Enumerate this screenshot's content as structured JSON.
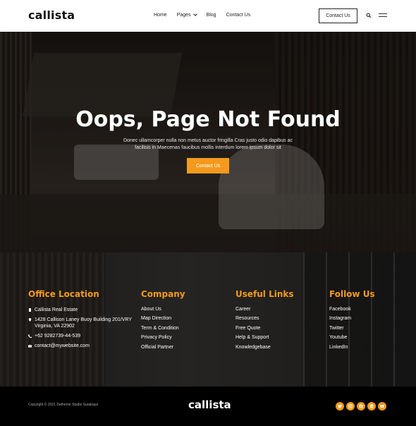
{
  "brand": {
    "name": "callista"
  },
  "nav": {
    "items": [
      "Home",
      "Pages",
      "Blog",
      "Contact Us"
    ],
    "cta_label": "Contact Us"
  },
  "hero": {
    "title": "Oops, Page Not Found",
    "subtitle": "Donec ullamcorper nulla non metus auctor fringilla Cras justo odio dapibus ac facilisis in Maecenas faucibus mollis interdum lorem ipsum dolor sit",
    "button_label": "Contact Us"
  },
  "footer": {
    "office": {
      "heading": "Office Location",
      "name": "Callista Real Estate",
      "address": "1428 Callison Laney Buoy Building 201/VRY Virginia, VA 22902",
      "phone": "+62 9282739-44-539",
      "email": "contact@mywebsite.com"
    },
    "company": {
      "heading": "Company",
      "links": [
        "About Us",
        "Map Direction",
        "Term & Condition",
        "Privacy Policy",
        "Official Partner"
      ]
    },
    "useful": {
      "heading": "Useful Links",
      "links": [
        "Career",
        "Resources",
        "Free Quote",
        "Help & Support",
        "Knowledgebase"
      ]
    },
    "follow": {
      "heading": "Follow Us",
      "links": [
        "Facebook",
        "Instagram",
        "Twitter",
        "Youtube",
        "LinkedIn"
      ]
    },
    "copyright": "Copyright © 2021 Detheme Studio Surabaya",
    "logo": "callista",
    "social_icons": [
      "twitter-icon",
      "instagram-icon",
      "facebook-icon",
      "linkedin-icon",
      "youtube-icon"
    ]
  },
  "colors": {
    "accent": "#f39a1e",
    "dark": "#000000",
    "header_bg": "#ffffff"
  }
}
